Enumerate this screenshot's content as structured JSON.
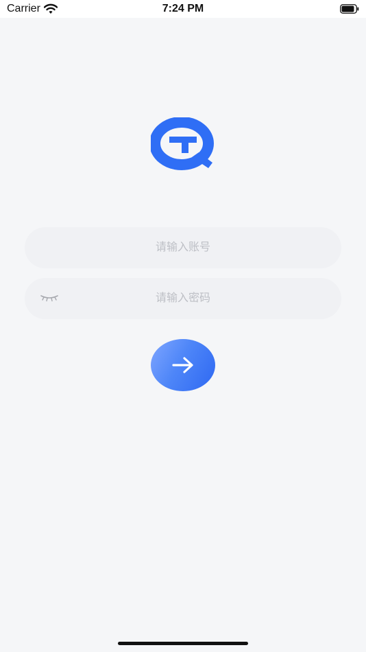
{
  "status_bar": {
    "carrier": "Carrier",
    "time": "7:24 PM",
    "icons": [
      "wifi-icon",
      "battery-icon"
    ]
  },
  "brand": {
    "logo_icon": "q-logo-icon",
    "accent_color": "#2F6EF5"
  },
  "login": {
    "account_placeholder": "请输入账号",
    "password_placeholder": "请输入密码",
    "password_toggle_icon": "eye-closed-icon",
    "submit_icon": "arrow-right-icon"
  }
}
